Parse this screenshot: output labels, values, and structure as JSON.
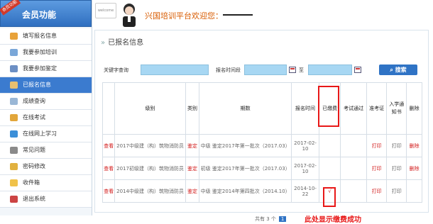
{
  "sidebar": {
    "ribbon": "会员功能",
    "title": "会员功能",
    "items": [
      {
        "label": "填写报名信息",
        "icon": "edit-icon"
      },
      {
        "label": "我要参加培训",
        "icon": "document-icon"
      },
      {
        "label": "我要参加鉴定",
        "icon": "certificate-icon"
      },
      {
        "label": "已报名信息",
        "icon": "box-icon"
      },
      {
        "label": "成绩查询",
        "icon": "search-icon"
      },
      {
        "label": "在线考试",
        "icon": "folder-icon"
      },
      {
        "label": "在线网上学习",
        "icon": "lightning-icon"
      },
      {
        "label": "常见问题",
        "icon": "question-icon"
      },
      {
        "label": "密码修改",
        "icon": "lock-icon"
      },
      {
        "label": "收件箱",
        "icon": "mail-icon"
      },
      {
        "label": "退出系统",
        "icon": "exit-icon"
      }
    ]
  },
  "header": {
    "logo_text": "welcome",
    "welcome_text": "兴国培训平台欢迎您："
  },
  "panel": {
    "title": "已报名信息",
    "search": {
      "keyword_label": "关键字查询",
      "date_label": "报名时间段",
      "to_label": "至",
      "button_label": "搜索"
    },
    "table": {
      "headers": [
        "",
        "级别",
        "类别",
        "期数",
        "报名时间",
        "已缴费",
        "考试通过",
        "准考证",
        "入学通知书",
        "删除"
      ],
      "rows": [
        {
          "view": "查看",
          "level": "2017中级建（构）筑物消防员",
          "category": "鉴定",
          "period": "中级 鉴定2017年第一批次（2017.03）",
          "time": "2017-02-10",
          "paid": "",
          "passed": "",
          "ticket": "打印",
          "notice": "打印",
          "delete": "删除"
        },
        {
          "view": "查看",
          "level": "2017初级建（构）筑物消防员",
          "category": "鉴定",
          "period": "初级 鉴定2017年第一批次（2017.03）",
          "time": "2017-02-10",
          "paid": "",
          "passed": "",
          "ticket": "打印",
          "notice": "打印",
          "delete": "删除"
        },
        {
          "view": "查看",
          "level": "2014中级建（构）筑物消防员",
          "category": "鉴定",
          "period": "中级 鉴定2014年第四批次（2014.10）",
          "time": "2014-10-22",
          "paid": "√",
          "passed": "",
          "ticket": "打印",
          "notice": "打印",
          "delete": ""
        }
      ]
    },
    "pager": {
      "text": "共有 3 个",
      "page": "1"
    },
    "annotation": "此处显示缴费成功"
  },
  "colors": {
    "accent": "#2f73c5",
    "red": "#e81818",
    "orange": "#d85b00"
  }
}
